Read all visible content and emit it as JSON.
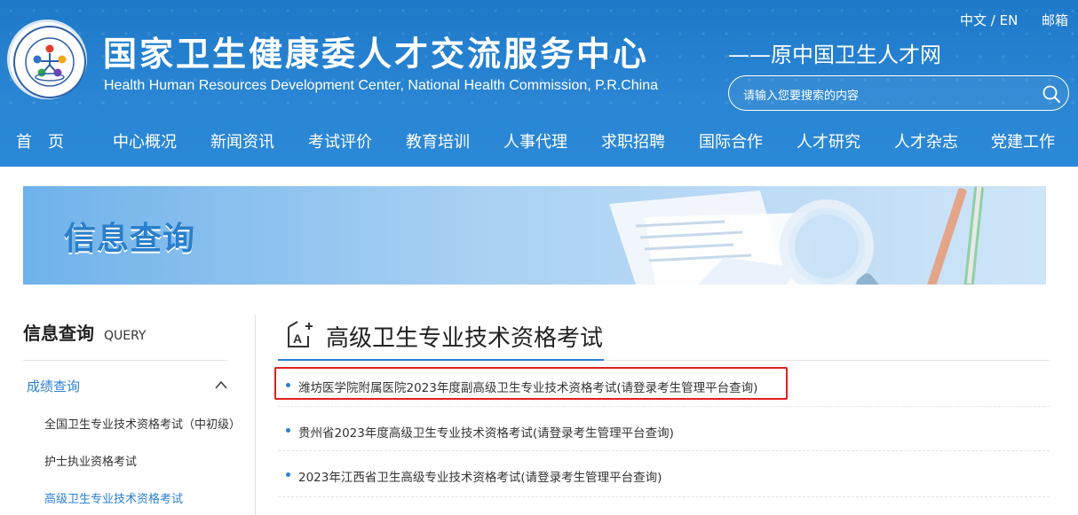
{
  "header": {
    "title_cn": "国家卫生健康委人才交流服务中心",
    "title_en": "Health Human Resources Development Center, National Health Commission, P.R.China",
    "subtitle": "——原中国卫生人才网",
    "lang": "中文 / EN",
    "mail": "邮箱",
    "search_placeholder": "请输入您要搜索的内容",
    "logo_icon": "organization-logo-icon",
    "logo_text": "国家卫生健康委人才交流服务中心"
  },
  "nav": [
    "首　页",
    "中心概况",
    "新闻资讯",
    "考试评价",
    "教育培训",
    "人事代理",
    "求职招聘",
    "国际合作",
    "人才研究",
    "人才杂志",
    "党建工作"
  ],
  "banner": {
    "title": "信息查询"
  },
  "sidebar": {
    "title": "信息查询",
    "title_en": "QUERY",
    "category": "成绩查询",
    "items": [
      "全国卫生专业技术资格考试（中初级）",
      "护士执业资格考试",
      "高级卫生专业技术资格考试"
    ]
  },
  "content": {
    "section_title": "高级卫生专业技术资格考试",
    "items": [
      "潍坊医学院附属医院2023年度副高级卫生专业技术资格考试(请登录考生管理平台查询)",
      "贵州省2023年度高级卫生专业技术资格考试(请登录考生管理平台查询)",
      "2023年江西省卫生高级专业技术资格考试(请登录考生管理平台查询)"
    ]
  },
  "colors": {
    "header_blue": "#2683d1",
    "accent": "#2b7fd0",
    "highlight_red": "#e02020"
  }
}
